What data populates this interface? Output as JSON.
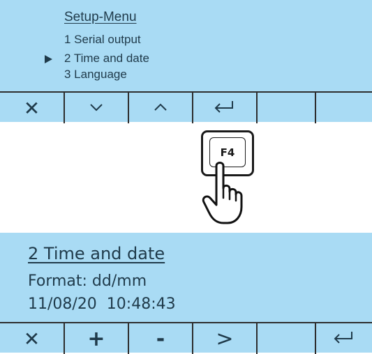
{
  "screen1": {
    "title": "Setup-Menu",
    "items": [
      {
        "label": "1 Serial output",
        "selected": false
      },
      {
        "label": "2 Time and date",
        "selected": true
      },
      {
        "label": "3 Language",
        "selected": false
      }
    ],
    "softkeys": [
      {
        "symbol": "✕",
        "icon": "close-icon"
      },
      {
        "symbol": "∨",
        "icon": "chevron-down-icon"
      },
      {
        "symbol": "∧",
        "icon": "chevron-up-icon"
      },
      {
        "symbol": "",
        "icon": "enter-icon"
      },
      {
        "symbol": "",
        "icon": ""
      },
      {
        "symbol": "",
        "icon": ""
      }
    ]
  },
  "key": {
    "label": "F4",
    "icon": "hand-pointer-icon"
  },
  "screen2": {
    "title": "2 Time and date",
    "format_line": "Format: dd/mm",
    "datetime_line": "11/08/20  10:48:43",
    "softkeys": [
      {
        "symbol": "✕",
        "icon": "close-icon"
      },
      {
        "symbol": "+",
        "icon": "plus-icon"
      },
      {
        "symbol": "-",
        "icon": "minus-icon"
      },
      {
        "symbol": ">",
        "icon": "chevron-right-icon"
      },
      {
        "symbol": "",
        "icon": ""
      },
      {
        "symbol": "",
        "icon": "enter-icon"
      }
    ]
  },
  "colors": {
    "lcd_background": "#a9dbf4",
    "lcd_text": "#1f3a4a",
    "divider": "#2d2d2d"
  }
}
